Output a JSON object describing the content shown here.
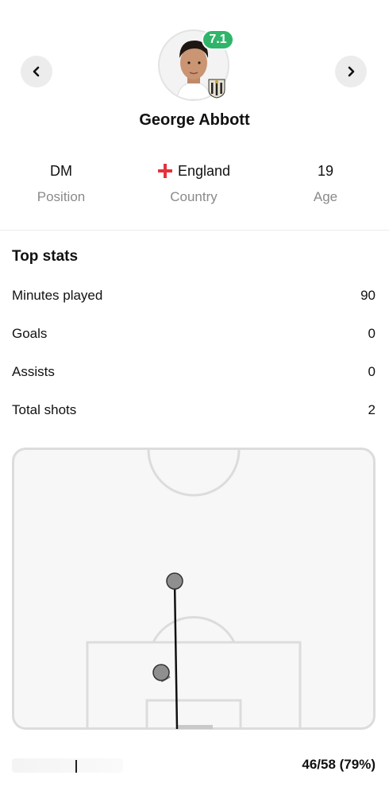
{
  "player": {
    "name": "George Abbott",
    "rating": "7.1",
    "rating_color": "#2fb56a"
  },
  "info": {
    "position_value": "DM",
    "position_label": "Position",
    "country_value": "England",
    "country_label": "Country",
    "age_value": "19",
    "age_label": "Age"
  },
  "top_stats": {
    "title": "Top stats",
    "rows": [
      {
        "label": "Minutes played",
        "value": "90"
      },
      {
        "label": "Goals",
        "value": "0"
      },
      {
        "label": "Assists",
        "value": "0"
      },
      {
        "label": "Total shots",
        "value": "2"
      }
    ]
  },
  "passes": {
    "value": "46/58 (79%)"
  },
  "icons": {
    "prev": "chevron-left-icon",
    "next": "chevron-right-icon",
    "flag": "england-flag-icon",
    "club": "club-crest-icon"
  }
}
